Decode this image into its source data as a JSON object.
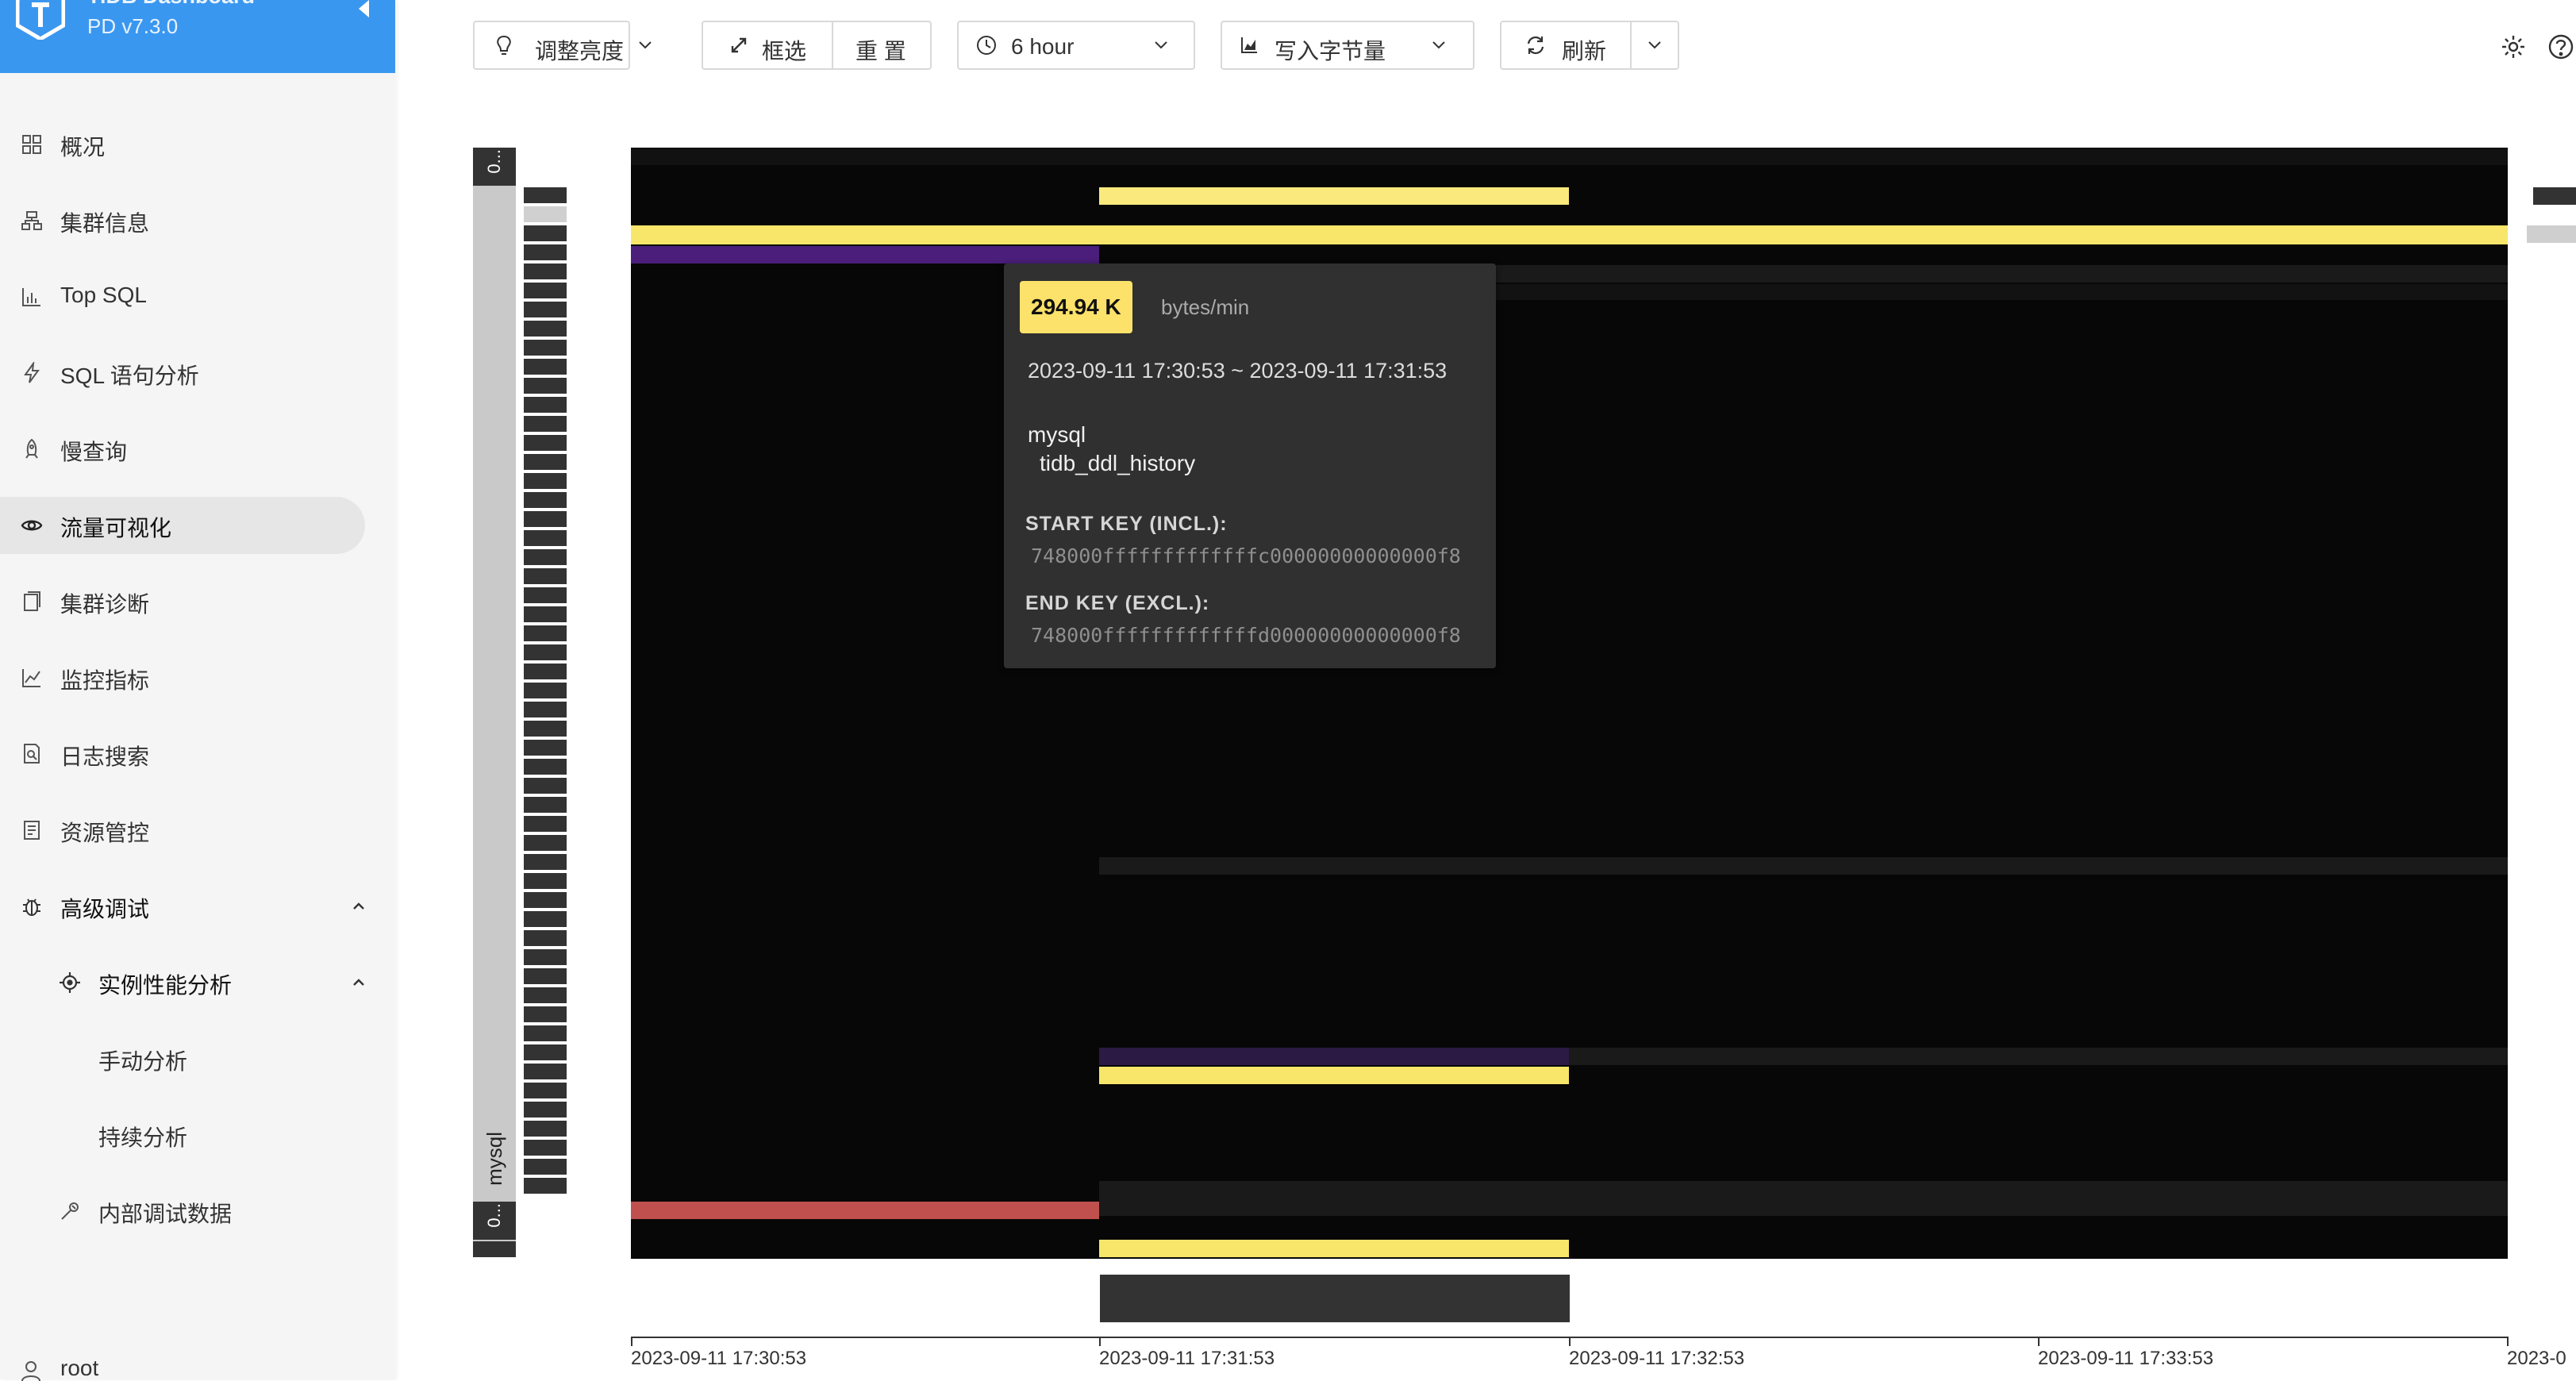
{
  "app": {
    "title": "TiDB Dashboard",
    "version": "PD v7.3.0"
  },
  "sidebar": {
    "items": [
      {
        "label": "概况",
        "icon": "grid-icon"
      },
      {
        "label": "集群信息",
        "icon": "cluster-icon"
      },
      {
        "label": "Top SQL",
        "icon": "bar-chart-icon"
      },
      {
        "label": "SQL 语句分析",
        "icon": "lightning-icon"
      },
      {
        "label": "慢查询",
        "icon": "rocket-icon"
      },
      {
        "label": "流量可视化",
        "icon": "eye-icon",
        "active": true
      },
      {
        "label": "集群诊断",
        "icon": "clipboard-icon"
      },
      {
        "label": "监控指标",
        "icon": "line-chart-icon"
      },
      {
        "label": "日志搜索",
        "icon": "file-search-icon"
      },
      {
        "label": "资源管控",
        "icon": "document-icon"
      },
      {
        "label": "高级调试",
        "icon": "bug-icon",
        "expanded": true
      },
      {
        "label": "实例性能分析",
        "icon": "target-icon",
        "expanded": true
      },
      {
        "label": "手动分析"
      },
      {
        "label": "持续分析"
      },
      {
        "label": "内部调试数据",
        "icon": "wrench-icon"
      }
    ],
    "user": "root"
  },
  "toolbar": {
    "brightness_label": "调整亮度",
    "select_label": "框选",
    "reset_label": "重 置",
    "time_range": "6 hour",
    "metric_label": "写入字节量",
    "refresh_label": "刷新"
  },
  "heatmap": {
    "db_label": "mysql",
    "endcap_top": "0...",
    "endcap_bottom": "0...",
    "x_ticks": [
      "2023-09-11 17:30:53",
      "2023-09-11 17:31:53",
      "2023-09-11 17:32:53",
      "2023-09-11 17:33:53",
      "2023-0"
    ],
    "colors": {
      "hot": "#fae97d",
      "yellow": "#f8e66a",
      "purple": "#4a1e7a",
      "dark_purple": "#2a1a44",
      "red": "#c0504d",
      "gray": "#333333",
      "faint": "#1a1a1a"
    }
  },
  "tooltip": {
    "value": "294.94 K",
    "unit": "bytes/min",
    "time_range": "2023-09-11 17:30:53 ~ 2023-09-11 17:31:53",
    "db": "mysql",
    "table": "tidb_ddl_history",
    "start_key_label": "START KEY (INCL.):",
    "start_key": "748000fffffffffffffc00000000000000f8",
    "end_key_label": "END KEY (EXCL.):",
    "end_key": "748000fffffffffffffd00000000000000f8"
  },
  "utility": {
    "settings_icon": "gear-icon",
    "help_icon": "question-circle-icon"
  }
}
